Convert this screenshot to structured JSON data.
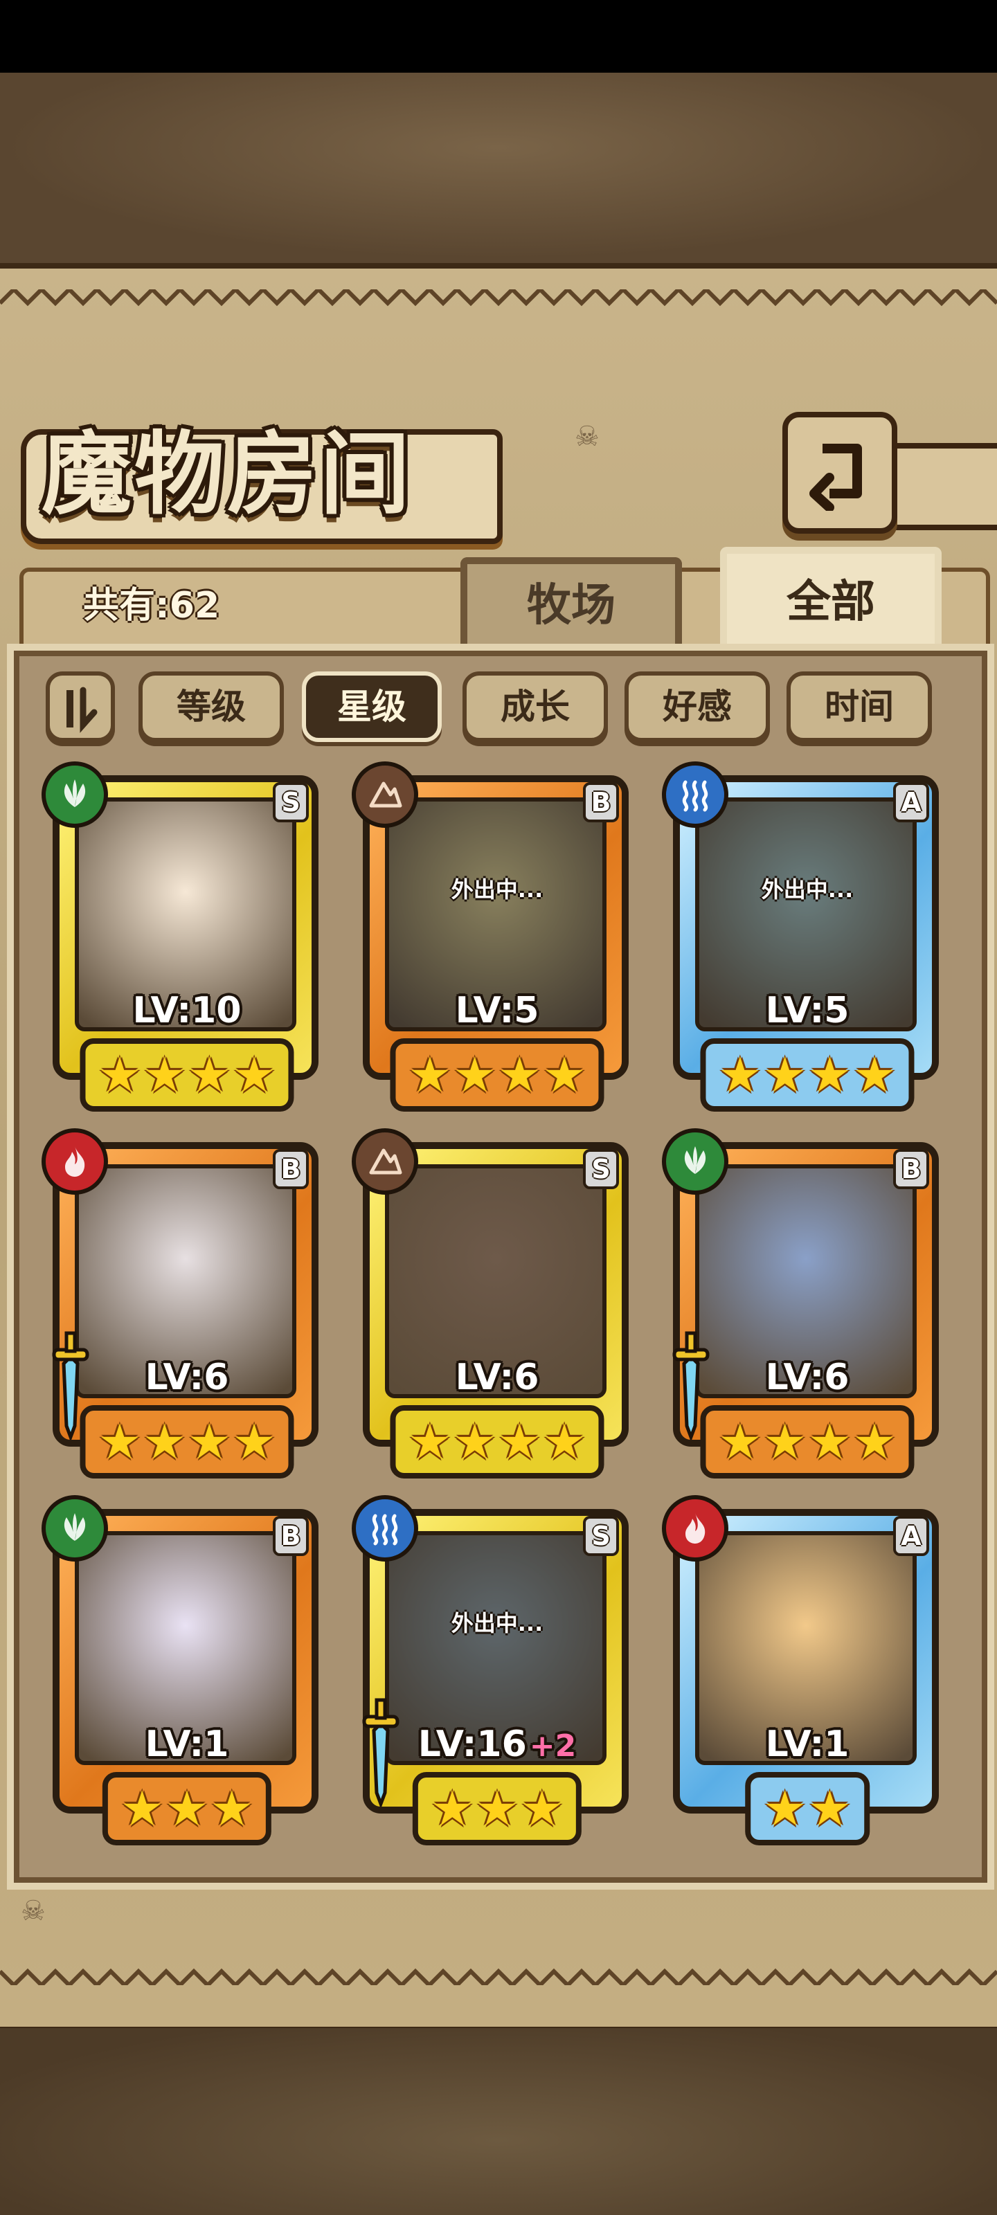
{
  "screen": {
    "title": "魔物房间",
    "total_label": "共有:62",
    "tabs": [
      {
        "label": "牧场",
        "active": false
      },
      {
        "label": "全部",
        "active": true
      }
    ],
    "sort_buttons": [
      {
        "label": "等级",
        "active": false
      },
      {
        "label": "星级",
        "active": true
      },
      {
        "label": "成长",
        "active": false
      },
      {
        "label": "好感",
        "active": false
      },
      {
        "label": "时间",
        "active": false
      }
    ]
  },
  "monsters": [
    {
      "rank": "S",
      "element": "leaf",
      "level": "LV:10",
      "bonus": "",
      "stars": 4,
      "away": "",
      "has_weapon": false
    },
    {
      "rank": "B",
      "element": "earth",
      "level": "LV:5",
      "bonus": "",
      "stars": 4,
      "away": "外出中...",
      "has_weapon": false
    },
    {
      "rank": "A",
      "element": "water",
      "level": "LV:5",
      "bonus": "",
      "stars": 4,
      "away": "外出中...",
      "has_weapon": false
    },
    {
      "rank": "B",
      "element": "fire",
      "level": "LV:6",
      "bonus": "",
      "stars": 4,
      "away": "",
      "has_weapon": true
    },
    {
      "rank": "S",
      "element": "earth",
      "level": "LV:6",
      "bonus": "",
      "stars": 4,
      "away": "",
      "has_weapon": false
    },
    {
      "rank": "B",
      "element": "leaf",
      "level": "LV:6",
      "bonus": "",
      "stars": 4,
      "away": "",
      "has_weapon": true
    },
    {
      "rank": "B",
      "element": "leaf",
      "level": "LV:1",
      "bonus": "",
      "stars": 3,
      "away": "",
      "has_weapon": false
    },
    {
      "rank": "S",
      "element": "water",
      "level": "LV:16",
      "bonus": "+2",
      "stars": 3,
      "away": "外出中...",
      "has_weapon": true
    },
    {
      "rank": "A",
      "element": "fire",
      "level": "LV:1",
      "bonus": "",
      "stars": 2,
      "away": "",
      "has_weapon": false
    }
  ],
  "colors": {
    "gold_frame": "#e2c21c",
    "orange_frame": "#e0781c",
    "blue_frame": "#5aaee6",
    "star": "#ffd21a",
    "bonus_pink": "#ff6fa8"
  }
}
